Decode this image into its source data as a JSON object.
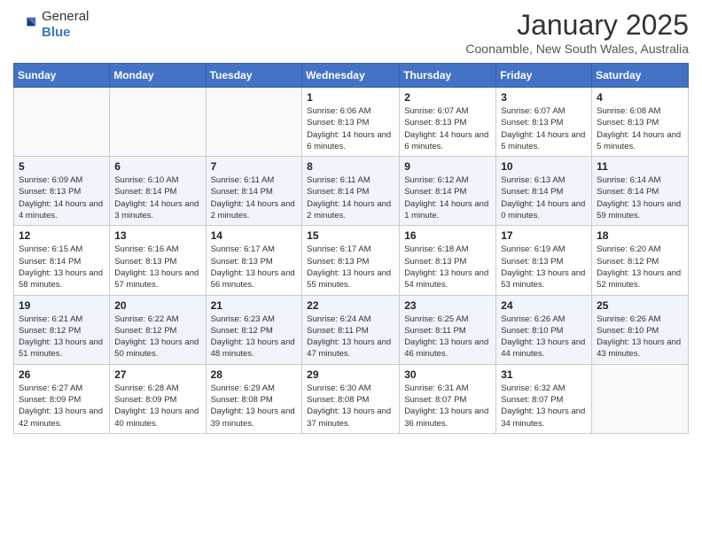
{
  "header": {
    "logo_general": "General",
    "logo_blue": "Blue",
    "month_title": "January 2025",
    "location": "Coonamble, New South Wales, Australia"
  },
  "weekdays": [
    "Sunday",
    "Monday",
    "Tuesday",
    "Wednesday",
    "Thursday",
    "Friday",
    "Saturday"
  ],
  "weeks": [
    [
      {
        "day": "",
        "sunrise": "",
        "sunset": "",
        "daylight": ""
      },
      {
        "day": "",
        "sunrise": "",
        "sunset": "",
        "daylight": ""
      },
      {
        "day": "",
        "sunrise": "",
        "sunset": "",
        "daylight": ""
      },
      {
        "day": "1",
        "sunrise": "Sunrise: 6:06 AM",
        "sunset": "Sunset: 8:13 PM",
        "daylight": "Daylight: 14 hours and 6 minutes."
      },
      {
        "day": "2",
        "sunrise": "Sunrise: 6:07 AM",
        "sunset": "Sunset: 8:13 PM",
        "daylight": "Daylight: 14 hours and 6 minutes."
      },
      {
        "day": "3",
        "sunrise": "Sunrise: 6:07 AM",
        "sunset": "Sunset: 8:13 PM",
        "daylight": "Daylight: 14 hours and 5 minutes."
      },
      {
        "day": "4",
        "sunrise": "Sunrise: 6:08 AM",
        "sunset": "Sunset: 8:13 PM",
        "daylight": "Daylight: 14 hours and 5 minutes."
      }
    ],
    [
      {
        "day": "5",
        "sunrise": "Sunrise: 6:09 AM",
        "sunset": "Sunset: 8:13 PM",
        "daylight": "Daylight: 14 hours and 4 minutes."
      },
      {
        "day": "6",
        "sunrise": "Sunrise: 6:10 AM",
        "sunset": "Sunset: 8:14 PM",
        "daylight": "Daylight: 14 hours and 3 minutes."
      },
      {
        "day": "7",
        "sunrise": "Sunrise: 6:11 AM",
        "sunset": "Sunset: 8:14 PM",
        "daylight": "Daylight: 14 hours and 2 minutes."
      },
      {
        "day": "8",
        "sunrise": "Sunrise: 6:11 AM",
        "sunset": "Sunset: 8:14 PM",
        "daylight": "Daylight: 14 hours and 2 minutes."
      },
      {
        "day": "9",
        "sunrise": "Sunrise: 6:12 AM",
        "sunset": "Sunset: 8:14 PM",
        "daylight": "Daylight: 14 hours and 1 minute."
      },
      {
        "day": "10",
        "sunrise": "Sunrise: 6:13 AM",
        "sunset": "Sunset: 8:14 PM",
        "daylight": "Daylight: 14 hours and 0 minutes."
      },
      {
        "day": "11",
        "sunrise": "Sunrise: 6:14 AM",
        "sunset": "Sunset: 8:14 PM",
        "daylight": "Daylight: 13 hours and 59 minutes."
      }
    ],
    [
      {
        "day": "12",
        "sunrise": "Sunrise: 6:15 AM",
        "sunset": "Sunset: 8:14 PM",
        "daylight": "Daylight: 13 hours and 58 minutes."
      },
      {
        "day": "13",
        "sunrise": "Sunrise: 6:16 AM",
        "sunset": "Sunset: 8:13 PM",
        "daylight": "Daylight: 13 hours and 57 minutes."
      },
      {
        "day": "14",
        "sunrise": "Sunrise: 6:17 AM",
        "sunset": "Sunset: 8:13 PM",
        "daylight": "Daylight: 13 hours and 56 minutes."
      },
      {
        "day": "15",
        "sunrise": "Sunrise: 6:17 AM",
        "sunset": "Sunset: 8:13 PM",
        "daylight": "Daylight: 13 hours and 55 minutes."
      },
      {
        "day": "16",
        "sunrise": "Sunrise: 6:18 AM",
        "sunset": "Sunset: 8:13 PM",
        "daylight": "Daylight: 13 hours and 54 minutes."
      },
      {
        "day": "17",
        "sunrise": "Sunrise: 6:19 AM",
        "sunset": "Sunset: 8:13 PM",
        "daylight": "Daylight: 13 hours and 53 minutes."
      },
      {
        "day": "18",
        "sunrise": "Sunrise: 6:20 AM",
        "sunset": "Sunset: 8:12 PM",
        "daylight": "Daylight: 13 hours and 52 minutes."
      }
    ],
    [
      {
        "day": "19",
        "sunrise": "Sunrise: 6:21 AM",
        "sunset": "Sunset: 8:12 PM",
        "daylight": "Daylight: 13 hours and 51 minutes."
      },
      {
        "day": "20",
        "sunrise": "Sunrise: 6:22 AM",
        "sunset": "Sunset: 8:12 PM",
        "daylight": "Daylight: 13 hours and 50 minutes."
      },
      {
        "day": "21",
        "sunrise": "Sunrise: 6:23 AM",
        "sunset": "Sunset: 8:12 PM",
        "daylight": "Daylight: 13 hours and 48 minutes."
      },
      {
        "day": "22",
        "sunrise": "Sunrise: 6:24 AM",
        "sunset": "Sunset: 8:11 PM",
        "daylight": "Daylight: 13 hours and 47 minutes."
      },
      {
        "day": "23",
        "sunrise": "Sunrise: 6:25 AM",
        "sunset": "Sunset: 8:11 PM",
        "daylight": "Daylight: 13 hours and 46 minutes."
      },
      {
        "day": "24",
        "sunrise": "Sunrise: 6:26 AM",
        "sunset": "Sunset: 8:10 PM",
        "daylight": "Daylight: 13 hours and 44 minutes."
      },
      {
        "day": "25",
        "sunrise": "Sunrise: 6:26 AM",
        "sunset": "Sunset: 8:10 PM",
        "daylight": "Daylight: 13 hours and 43 minutes."
      }
    ],
    [
      {
        "day": "26",
        "sunrise": "Sunrise: 6:27 AM",
        "sunset": "Sunset: 8:09 PM",
        "daylight": "Daylight: 13 hours and 42 minutes."
      },
      {
        "day": "27",
        "sunrise": "Sunrise: 6:28 AM",
        "sunset": "Sunset: 8:09 PM",
        "daylight": "Daylight: 13 hours and 40 minutes."
      },
      {
        "day": "28",
        "sunrise": "Sunrise: 6:29 AM",
        "sunset": "Sunset: 8:08 PM",
        "daylight": "Daylight: 13 hours and 39 minutes."
      },
      {
        "day": "29",
        "sunrise": "Sunrise: 6:30 AM",
        "sunset": "Sunset: 8:08 PM",
        "daylight": "Daylight: 13 hours and 37 minutes."
      },
      {
        "day": "30",
        "sunrise": "Sunrise: 6:31 AM",
        "sunset": "Sunset: 8:07 PM",
        "daylight": "Daylight: 13 hours and 36 minutes."
      },
      {
        "day": "31",
        "sunrise": "Sunrise: 6:32 AM",
        "sunset": "Sunset: 8:07 PM",
        "daylight": "Daylight: 13 hours and 34 minutes."
      },
      {
        "day": "",
        "sunrise": "",
        "sunset": "",
        "daylight": ""
      }
    ]
  ]
}
